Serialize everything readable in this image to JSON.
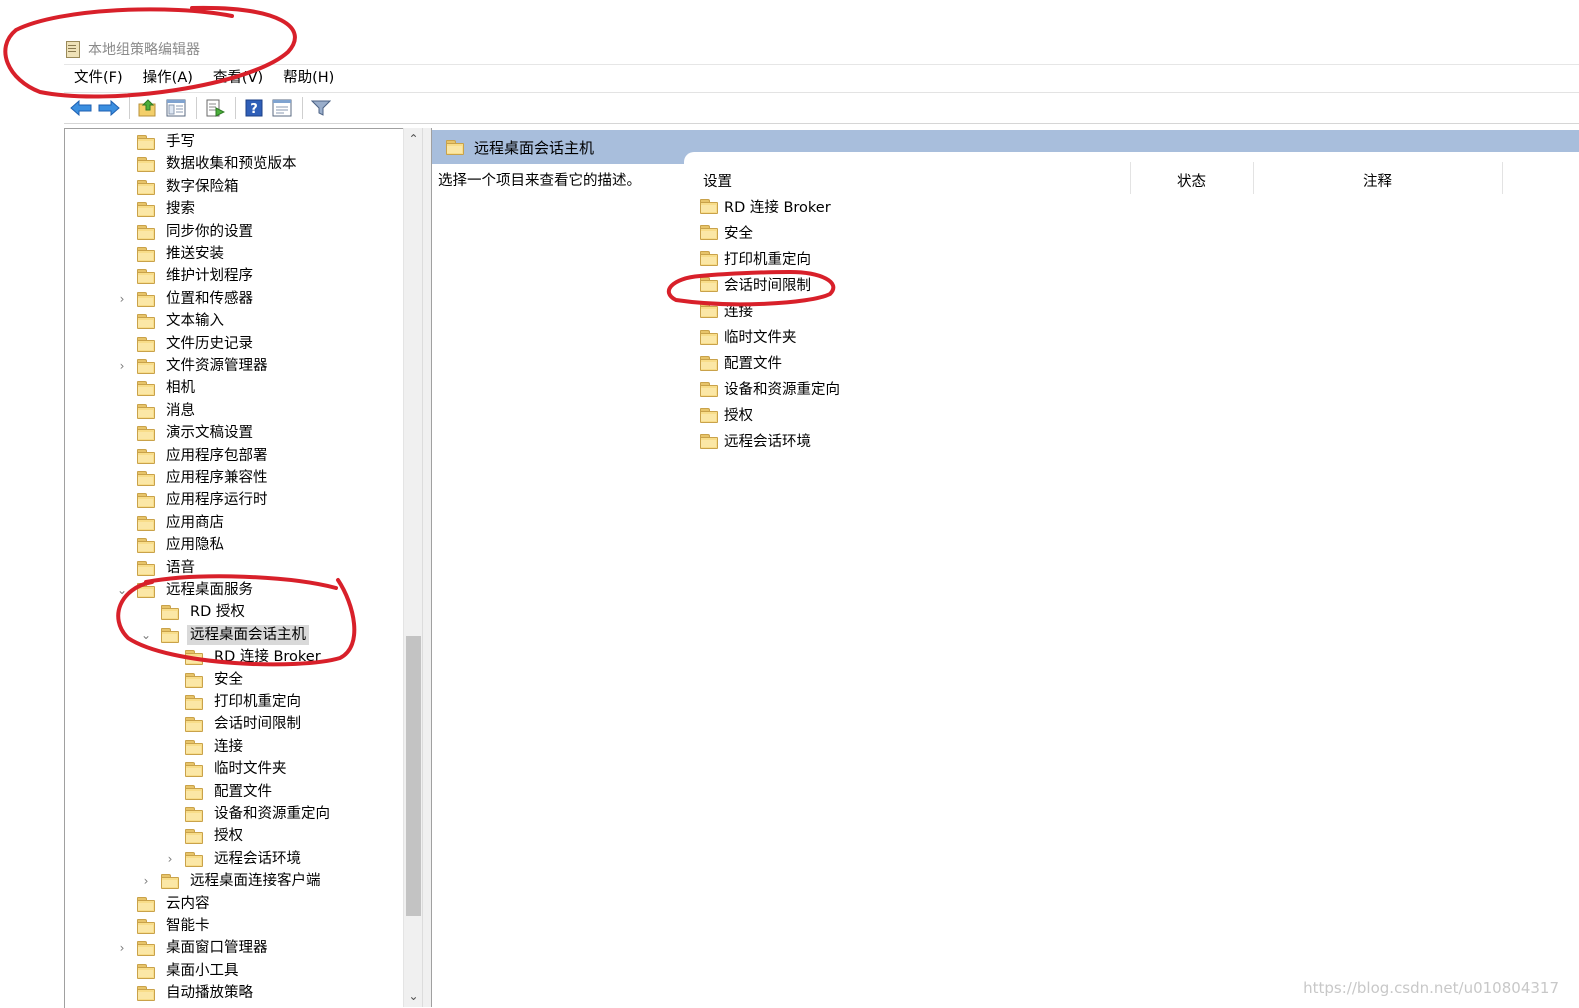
{
  "window": {
    "title": "本地组策略编辑器"
  },
  "menubar": {
    "items": [
      "文件(F)",
      "操作(A)",
      "查看(V)",
      "帮助(H)"
    ]
  },
  "toolbar": {
    "buttons": [
      {
        "icon": "back-arrow-icon"
      },
      {
        "icon": "forward-arrow-icon"
      },
      {
        "icon": "up-folder-icon"
      },
      {
        "icon": "show-hide-tree-icon"
      },
      {
        "icon": "export-list-icon"
      },
      {
        "icon": "help-icon"
      },
      {
        "icon": "properties-icon"
      },
      {
        "icon": "filter-icon"
      }
    ]
  },
  "tree": {
    "items": [
      {
        "label": "手写",
        "level": 0,
        "expander": ""
      },
      {
        "label": "数据收集和预览版本",
        "level": 0,
        "expander": ""
      },
      {
        "label": "数字保险箱",
        "level": 0,
        "expander": ""
      },
      {
        "label": "搜索",
        "level": 0,
        "expander": ""
      },
      {
        "label": "同步你的设置",
        "level": 0,
        "expander": ""
      },
      {
        "label": "推送安装",
        "level": 0,
        "expander": ""
      },
      {
        "label": "维护计划程序",
        "level": 0,
        "expander": ""
      },
      {
        "label": "位置和传感器",
        "level": 0,
        "expander": "›"
      },
      {
        "label": "文本输入",
        "level": 0,
        "expander": ""
      },
      {
        "label": "文件历史记录",
        "level": 0,
        "expander": ""
      },
      {
        "label": "文件资源管理器",
        "level": 0,
        "expander": "›"
      },
      {
        "label": "相机",
        "level": 0,
        "expander": ""
      },
      {
        "label": "消息",
        "level": 0,
        "expander": ""
      },
      {
        "label": "演示文稿设置",
        "level": 0,
        "expander": ""
      },
      {
        "label": "应用程序包部署",
        "level": 0,
        "expander": ""
      },
      {
        "label": "应用程序兼容性",
        "level": 0,
        "expander": ""
      },
      {
        "label": "应用程序运行时",
        "level": 0,
        "expander": ""
      },
      {
        "label": "应用商店",
        "level": 0,
        "expander": ""
      },
      {
        "label": "应用隐私",
        "level": 0,
        "expander": ""
      },
      {
        "label": "语音",
        "level": 0,
        "expander": ""
      },
      {
        "label": "远程桌面服务",
        "level": 0,
        "expander": "⌄"
      },
      {
        "label": "RD 授权",
        "level": 1,
        "expander": ""
      },
      {
        "label": "远程桌面会话主机",
        "level": 1,
        "expander": "⌄",
        "selected": true
      },
      {
        "label": "RD 连接 Broker",
        "level": 2,
        "expander": ""
      },
      {
        "label": "安全",
        "level": 2,
        "expander": ""
      },
      {
        "label": "打印机重定向",
        "level": 2,
        "expander": ""
      },
      {
        "label": "会话时间限制",
        "level": 2,
        "expander": ""
      },
      {
        "label": "连接",
        "level": 2,
        "expander": ""
      },
      {
        "label": "临时文件夹",
        "level": 2,
        "expander": ""
      },
      {
        "label": "配置文件",
        "level": 2,
        "expander": ""
      },
      {
        "label": "设备和资源重定向",
        "level": 2,
        "expander": ""
      },
      {
        "label": "授权",
        "level": 2,
        "expander": ""
      },
      {
        "label": "远程会话环境",
        "level": 2,
        "expander": "›"
      },
      {
        "label": "远程桌面连接客户端",
        "level": 1,
        "expander": "›"
      },
      {
        "label": "云内容",
        "level": 0,
        "expander": ""
      },
      {
        "label": "智能卡",
        "level": 0,
        "expander": ""
      },
      {
        "label": "桌面窗口管理器",
        "level": 0,
        "expander": "›"
      },
      {
        "label": "桌面小工具",
        "level": 0,
        "expander": ""
      },
      {
        "label": "自动播放策略",
        "level": 0,
        "expander": ""
      }
    ]
  },
  "details": {
    "header_title": "远程桌面会话主机",
    "description": "选择一个项目来查看它的描述。",
    "columns": [
      "设置",
      "状态",
      "注释"
    ],
    "items": [
      "RD 连接 Broker",
      "安全",
      "打印机重定向",
      "会话时间限制",
      "连接",
      "临时文件夹",
      "配置文件",
      "设备和资源重定向",
      "授权",
      "远程会话环境"
    ]
  },
  "watermark": "https://blog.csdn.net/u010804317",
  "colors": {
    "header_bg": "#a8bedc",
    "selection_bg": "#d9d9d9",
    "annotation_red": "#d8202a",
    "folder_yellow": "#f8dd8a"
  }
}
